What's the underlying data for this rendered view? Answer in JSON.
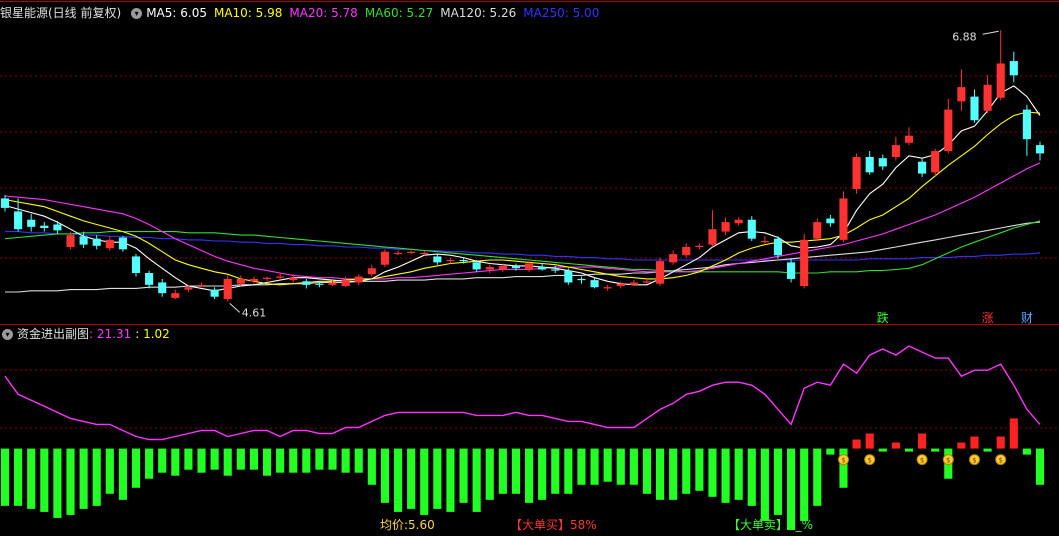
{
  "header": {
    "stock": "银星能源(日线 前复权)",
    "ma": [
      {
        "label": "MA5: 6.05",
        "color": "#ffffff"
      },
      {
        "label": "MA10: 5.98",
        "color": "#ffff00"
      },
      {
        "label": "MA20: 5.78",
        "color": "#ff33ff"
      },
      {
        "label": "MA60: 5.27",
        "color": "#33dd33"
      },
      {
        "label": "MA120: 5.26",
        "color": "#dddddd"
      },
      {
        "label": "MA250: 5.00",
        "color": "#3333ff"
      }
    ]
  },
  "sub_header": {
    "title": "资金进出副图",
    "v1": ": 21.31",
    "v2": ": 1.02"
  },
  "markers": {
    "high_label": "6.88",
    "low_label": "4.61",
    "tags": [
      "跌",
      "涨",
      "财"
    ]
  },
  "footer": {
    "avg_label": "均价:5.60",
    "big_buy_label": "【大单买】",
    "big_buy_value": "58%",
    "big_sell_label": "【大单卖】",
    "big_sell_value": "4_%"
  },
  "colors": {
    "up": "#ff3232",
    "down": "#54ffff",
    "grid": "#8b0000",
    "ma5": "#ffffff",
    "ma10": "#ffff00",
    "ma20": "#ff33ff",
    "ma60": "#33dd33",
    "ma120": "#dddddd",
    "ma250": "#3333ff",
    "fund_line": "#ff33ff",
    "bar_pos": "#ff2222",
    "bar_neg": "#22ff22"
  },
  "chart_data": [
    {
      "type": "candlestick",
      "title": "银星能源(日线 前复权)",
      "y_range": [
        4.45,
        6.95
      ],
      "candles": [
        [
          5.46,
          5.38,
          5.49,
          5.35
        ],
        [
          5.35,
          5.2,
          5.46,
          5.18
        ],
        [
          5.28,
          5.22,
          5.33,
          5.18
        ],
        [
          5.23,
          5.21,
          5.26,
          5.18
        ],
        [
          5.24,
          5.19,
          5.27,
          5.16
        ],
        [
          5.05,
          5.15,
          5.18,
          5.03
        ],
        [
          5.14,
          5.07,
          5.18,
          5.04
        ],
        [
          5.12,
          5.06,
          5.15,
          5.03
        ],
        [
          5.04,
          5.11,
          5.14,
          5.02
        ],
        [
          5.13,
          5.03,
          5.14,
          5.01
        ],
        [
          4.97,
          4.83,
          4.99,
          4.8
        ],
        [
          4.83,
          4.73,
          4.85,
          4.7
        ],
        [
          4.75,
          4.66,
          4.78,
          4.63
        ],
        [
          4.62,
          4.66,
          4.69,
          4.61
        ],
        [
          4.69,
          4.71,
          4.73,
          4.67
        ],
        [
          4.73,
          4.73,
          4.75,
          4.71
        ],
        [
          4.69,
          4.63,
          4.71,
          4.61
        ],
        [
          4.61,
          4.78,
          4.81,
          4.59
        ],
        [
          4.74,
          4.78,
          4.81,
          4.72
        ],
        [
          4.76,
          4.78,
          4.8,
          4.74
        ],
        [
          4.78,
          4.79,
          4.8,
          4.76
        ],
        [
          4.8,
          4.8,
          4.83,
          4.77
        ],
        [
          4.77,
          4.79,
          4.82,
          4.75
        ],
        [
          4.76,
          4.73,
          4.78,
          4.7
        ],
        [
          4.74,
          4.73,
          4.76,
          4.71
        ],
        [
          4.73,
          4.75,
          4.77,
          4.72
        ],
        [
          4.72,
          4.77,
          4.8,
          4.71
        ],
        [
          4.75,
          4.8,
          4.82,
          4.73
        ],
        [
          4.82,
          4.87,
          4.9,
          4.8
        ],
        [
          4.9,
          5.01,
          5.03,
          4.88
        ],
        [
          5.0,
          5.0,
          5.02,
          4.98
        ],
        [
          5.01,
          5.01,
          5.02,
          4.99
        ],
        [
          5.0,
          5.0,
          5.02,
          4.98
        ],
        [
          4.97,
          4.92,
          4.99,
          4.9
        ],
        [
          4.93,
          4.94,
          4.96,
          4.91
        ],
        [
          4.94,
          4.93,
          4.96,
          4.91
        ],
        [
          4.92,
          4.86,
          4.94,
          4.84
        ],
        [
          4.86,
          4.88,
          4.9,
          4.83
        ],
        [
          4.86,
          4.89,
          4.91,
          4.84
        ],
        [
          4.89,
          4.87,
          4.91,
          4.85
        ],
        [
          4.86,
          4.91,
          4.93,
          4.84
        ],
        [
          4.88,
          4.86,
          4.91,
          4.85
        ],
        [
          4.86,
          4.85,
          4.89,
          4.83
        ],
        [
          4.85,
          4.75,
          4.87,
          4.73
        ],
        [
          4.78,
          4.77,
          4.8,
          4.74
        ],
        [
          4.77,
          4.71,
          4.79,
          4.7
        ],
        [
          4.71,
          4.71,
          4.73,
          4.68
        ],
        [
          4.72,
          4.74,
          4.76,
          4.7
        ],
        [
          4.73,
          4.75,
          4.77,
          4.72
        ],
        [
          4.76,
          4.76,
          4.78,
          4.74
        ],
        [
          4.74,
          4.93,
          4.96,
          4.72
        ],
        [
          4.92,
          4.99,
          5.02,
          4.9
        ],
        [
          4.98,
          5.05,
          5.08,
          4.96
        ],
        [
          5.05,
          5.06,
          5.08,
          5.03
        ],
        [
          5.07,
          5.2,
          5.36,
          5.05
        ],
        [
          5.18,
          5.26,
          5.3,
          5.15
        ],
        [
          5.25,
          5.28,
          5.3,
          5.23
        ],
        [
          5.28,
          5.12,
          5.31,
          5.1
        ],
        [
          5.1,
          5.1,
          5.14,
          5.08
        ],
        [
          5.12,
          4.98,
          5.14,
          4.95
        ],
        [
          4.92,
          4.78,
          4.95,
          4.75
        ],
        [
          4.72,
          5.11,
          5.16,
          4.7
        ],
        [
          5.12,
          5.26,
          5.29,
          5.1
        ],
        [
          5.29,
          5.25,
          5.32,
          5.22
        ],
        [
          5.11,
          5.46,
          5.52,
          5.09
        ],
        [
          5.54,
          5.81,
          5.84,
          5.5
        ],
        [
          5.81,
          5.68,
          5.86,
          5.66
        ],
        [
          5.8,
          5.73,
          5.83,
          5.7
        ],
        [
          5.81,
          5.91,
          5.98,
          5.78
        ],
        [
          5.93,
          5.99,
          6.06,
          5.91
        ],
        [
          5.77,
          5.67,
          5.8,
          5.64
        ],
        [
          5.68,
          5.86,
          5.88,
          5.65
        ],
        [
          5.86,
          6.21,
          6.3,
          5.84
        ],
        [
          6.28,
          6.4,
          6.55,
          6.2
        ],
        [
          6.32,
          6.12,
          6.38,
          6.1
        ],
        [
          6.2,
          6.42,
          6.5,
          6.18
        ],
        [
          6.31,
          6.6,
          6.88,
          6.29
        ],
        [
          6.62,
          6.5,
          6.7,
          6.44
        ],
        [
          6.21,
          5.96,
          6.25,
          5.82
        ],
        [
          5.91,
          5.84,
          5.94,
          5.78
        ]
      ],
      "ma5": [
        5.4,
        5.37,
        5.34,
        5.31,
        5.26,
        5.2,
        5.14,
        5.11,
        5.09,
        5.09,
        5.04,
        4.95,
        4.87,
        4.79,
        4.72,
        4.7,
        4.68,
        4.7,
        4.72,
        4.73,
        4.75,
        4.77,
        4.79,
        4.79,
        4.78,
        4.77,
        4.76,
        4.76,
        4.78,
        4.84,
        4.88,
        4.93,
        4.98,
        4.99,
        4.98,
        4.96,
        4.93,
        4.91,
        4.9,
        4.89,
        4.89,
        4.88,
        4.87,
        4.85,
        4.83,
        4.79,
        4.76,
        4.74,
        4.73,
        4.73,
        4.78,
        4.84,
        4.9,
        4.96,
        5.05,
        5.11,
        5.17,
        5.18,
        5.17,
        5.13,
        5.06,
        5.04,
        5.05,
        5.07,
        5.17,
        5.36,
        5.5,
        5.58,
        5.72,
        5.82,
        5.8,
        5.83,
        5.91,
        6.03,
        6.07,
        6.2,
        6.35,
        6.41,
        6.32,
        6.16
      ],
      "ma10": [
        5.45,
        5.43,
        5.41,
        5.39,
        5.35,
        5.31,
        5.27,
        5.24,
        5.21,
        5.18,
        5.14,
        5.08,
        5.01,
        4.94,
        4.9,
        4.87,
        4.84,
        4.82,
        4.78,
        4.76,
        4.74,
        4.73,
        4.74,
        4.75,
        4.76,
        4.76,
        4.77,
        4.78,
        4.78,
        4.8,
        4.82,
        4.84,
        4.87,
        4.89,
        4.91,
        4.92,
        4.93,
        4.94,
        4.94,
        4.93,
        4.92,
        4.91,
        4.9,
        4.88,
        4.86,
        4.84,
        4.82,
        4.8,
        4.79,
        4.78,
        4.78,
        4.79,
        4.81,
        4.84,
        4.89,
        4.94,
        5.0,
        5.04,
        5.07,
        5.09,
        5.09,
        5.1,
        5.11,
        5.12,
        5.15,
        5.21,
        5.28,
        5.32,
        5.39,
        5.46,
        5.56,
        5.65,
        5.74,
        5.82,
        5.9,
        6.0,
        6.09,
        6.16,
        6.19,
        6.18
      ],
      "ma20": [
        5.48,
        5.47,
        5.46,
        5.45,
        5.43,
        5.41,
        5.39,
        5.37,
        5.35,
        5.33,
        5.29,
        5.24,
        5.18,
        5.12,
        5.07,
        5.02,
        4.97,
        4.93,
        4.9,
        4.87,
        4.85,
        4.83,
        4.81,
        4.8,
        4.79,
        4.79,
        4.78,
        4.78,
        4.78,
        4.78,
        4.79,
        4.79,
        4.8,
        4.81,
        4.82,
        4.83,
        4.84,
        4.85,
        4.86,
        4.86,
        4.86,
        4.87,
        4.88,
        4.88,
        4.88,
        4.88,
        4.87,
        4.86,
        4.85,
        4.84,
        4.84,
        4.84,
        4.84,
        4.85,
        4.87,
        4.89,
        4.91,
        4.93,
        4.95,
        4.97,
        4.99,
        5.01,
        5.03,
        5.05,
        5.07,
        5.1,
        5.13,
        5.16,
        5.2,
        5.24,
        5.28,
        5.32,
        5.37,
        5.42,
        5.47,
        5.53,
        5.59,
        5.65,
        5.71,
        5.76
      ],
      "ma60": [
        5.12,
        5.13,
        5.14,
        5.15,
        5.16,
        5.16,
        5.17,
        5.17,
        5.18,
        5.18,
        5.18,
        5.18,
        5.18,
        5.18,
        5.17,
        5.17,
        5.17,
        5.16,
        5.15,
        5.15,
        5.14,
        5.13,
        5.12,
        5.11,
        5.1,
        5.09,
        5.08,
        5.07,
        5.06,
        5.05,
        5.04,
        5.03,
        5.02,
        5.01,
        5.0,
        4.99,
        4.98,
        4.97,
        4.96,
        4.95,
        4.94,
        4.93,
        4.92,
        4.91,
        4.9,
        4.89,
        4.88,
        4.87,
        4.86,
        4.86,
        4.85,
        4.85,
        4.84,
        4.84,
        4.84,
        4.84,
        4.84,
        4.84,
        4.84,
        4.84,
        4.83,
        4.83,
        4.83,
        4.84,
        4.84,
        4.84,
        4.85,
        4.85,
        4.86,
        4.87,
        4.9,
        4.95,
        5.0,
        5.05,
        5.09,
        5.13,
        5.17,
        5.21,
        5.24,
        5.27
      ],
      "ma120": [
        4.67,
        4.67,
        4.68,
        4.68,
        4.68,
        4.69,
        4.69,
        4.69,
        4.7,
        4.7,
        4.7,
        4.71,
        4.71,
        4.71,
        4.72,
        4.72,
        4.72,
        4.72,
        4.73,
        4.73,
        4.73,
        4.74,
        4.74,
        4.74,
        4.75,
        4.75,
        4.75,
        4.76,
        4.76,
        4.76,
        4.77,
        4.77,
        4.77,
        4.78,
        4.78,
        4.78,
        4.79,
        4.79,
        4.79,
        4.8,
        4.8,
        4.8,
        4.81,
        4.81,
        4.81,
        4.82,
        4.82,
        4.82,
        4.83,
        4.83,
        4.84,
        4.85,
        4.86,
        4.87,
        4.88,
        4.9,
        4.91,
        4.92,
        4.93,
        4.94,
        4.95,
        4.96,
        4.97,
        4.98,
        4.99,
        5.0,
        5.01,
        5.03,
        5.05,
        5.07,
        5.09,
        5.11,
        5.13,
        5.15,
        5.17,
        5.19,
        5.21,
        5.23,
        5.25,
        5.26
      ],
      "ma250": [
        5.18,
        5.18,
        5.17,
        5.17,
        5.16,
        5.16,
        5.15,
        5.15,
        5.14,
        5.14,
        5.13,
        5.13,
        5.12,
        5.12,
        5.11,
        5.11,
        5.1,
        5.1,
        5.09,
        5.09,
        5.08,
        5.08,
        5.07,
        5.07,
        5.06,
        5.06,
        5.05,
        5.05,
        5.04,
        5.04,
        5.03,
        5.03,
        5.02,
        5.02,
        5.01,
        5.01,
        5.0,
        5.0,
        4.99,
        4.99,
        4.98,
        4.98,
        4.97,
        4.97,
        4.96,
        4.96,
        4.95,
        4.95,
        4.94,
        4.94,
        4.94,
        4.94,
        4.94,
        4.94,
        4.94,
        4.94,
        4.94,
        4.94,
        4.94,
        4.94,
        4.94,
        4.94,
        4.94,
        4.94,
        4.94,
        4.94,
        4.95,
        4.95,
        4.95,
        4.95,
        4.96,
        4.96,
        4.96,
        4.97,
        4.97,
        4.98,
        4.98,
        4.99,
        4.99,
        5.0
      ]
    },
    {
      "type": "bar+line",
      "title": "资金进出副图",
      "y_range": [
        -27,
        36
      ],
      "line": [
        24,
        18,
        16,
        14,
        12,
        10,
        9,
        8,
        8,
        6,
        4,
        3,
        3,
        4,
        5,
        6,
        6,
        4,
        5,
        6,
        6,
        4,
        6,
        6,
        5,
        5,
        7,
        7,
        9,
        11,
        12,
        12,
        12,
        12,
        12,
        12,
        11,
        11,
        11,
        12,
        11,
        11,
        10,
        9,
        9,
        8,
        7,
        7,
        7,
        10,
        13,
        15,
        18,
        19,
        21,
        22,
        22,
        21,
        18,
        13,
        8,
        20,
        22,
        21,
        28,
        25,
        31,
        33,
        31,
        34,
        32,
        30,
        30,
        24,
        26,
        26,
        28,
        21,
        13,
        8
      ],
      "bars": [
        -19,
        -19,
        -20,
        -21,
        -23,
        -22,
        -20,
        -19,
        -15,
        -17,
        -13,
        -10,
        -8,
        -9,
        -7,
        -8,
        -7,
        -9,
        -7,
        -7,
        -9,
        -8,
        -8,
        -8,
        -7,
        -7,
        -8,
        -8,
        -12,
        -18,
        -21,
        -20,
        -22,
        -20,
        -21,
        -18,
        -21,
        -17,
        -15,
        -15,
        -18,
        -17,
        -15,
        -15,
        -12,
        -12,
        -11,
        -12,
        -12,
        -15,
        -17,
        -17,
        -15,
        -14,
        -16,
        -18,
        -17,
        -19,
        -24,
        -22,
        -27,
        -24,
        -19,
        -2,
        -13,
        3,
        5,
        -1,
        2,
        -1,
        5,
        -1,
        -10,
        2,
        4,
        -1,
        4,
        10,
        -2,
        -12
      ],
      "signal_days": [
        64,
        66,
        70,
        72,
        74,
        76
      ]
    }
  ]
}
